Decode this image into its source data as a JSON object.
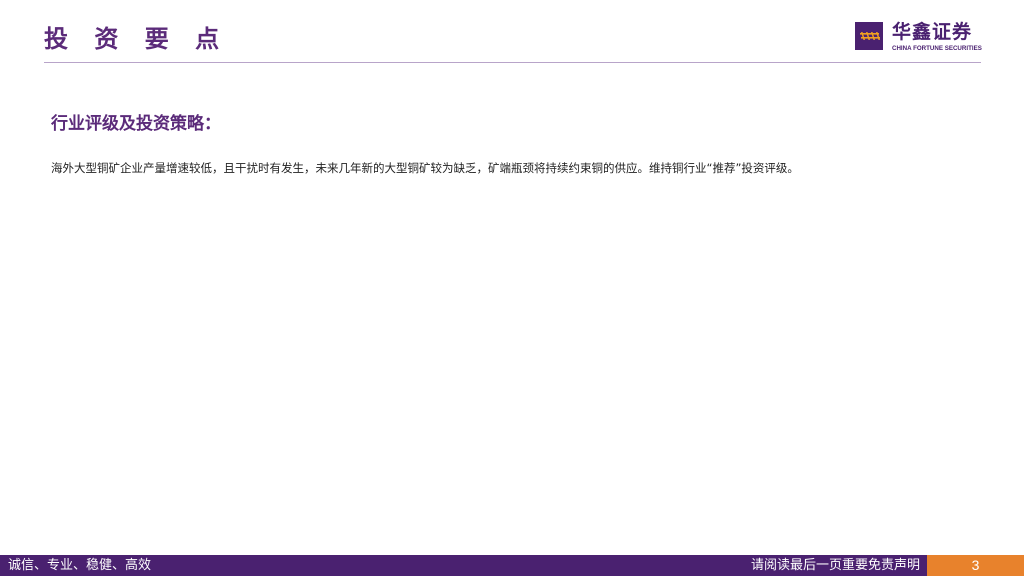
{
  "header": {
    "title": "投 资 要 点",
    "logo_cn": "华鑫证券",
    "logo_en": "CHINA FORTUNE SECURITIES"
  },
  "content": {
    "heading": "行业评级及投资策略：",
    "paragraph": "海外大型铜矿企业产量增速较低，且干扰时有发生，未来几年新的大型铜矿较为缺乏，矿端瓶颈将持续约束铜的供应。维持铜行业“推荐”投资评级。"
  },
  "footer": {
    "slogan": "诚信、专业、稳健、高效",
    "disclaimer": "请阅读最后一页重要免责声明",
    "page_number": "3"
  },
  "colors": {
    "brand_purple": "#4a2170",
    "title_purple": "#5b2b7a",
    "accent_orange": "#e8822c",
    "rule": "#b8a4c9"
  },
  "icons": {
    "logo_mark": "brand-logo-icon"
  }
}
